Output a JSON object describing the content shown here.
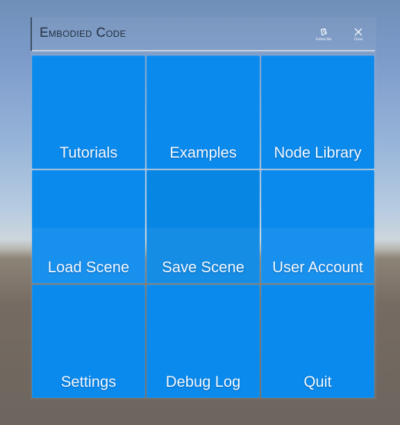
{
  "window": {
    "title": "Embodied Code",
    "follow_me": {
      "label": "Follow Me",
      "icon": "follow-me-icon"
    },
    "close": {
      "label": "Close",
      "icon": "close-icon"
    }
  },
  "menu": {
    "tiles": [
      {
        "label": "Tutorials"
      },
      {
        "label": "Examples"
      },
      {
        "label": "Node Library"
      },
      {
        "label": "Load Scene"
      },
      {
        "label": "Save Scene"
      },
      {
        "label": "User Account"
      },
      {
        "label": "Settings"
      },
      {
        "label": "Debug Log"
      },
      {
        "label": "Quit"
      }
    ]
  },
  "colors": {
    "tile": "#0a8aec",
    "title_text": "#233040"
  }
}
